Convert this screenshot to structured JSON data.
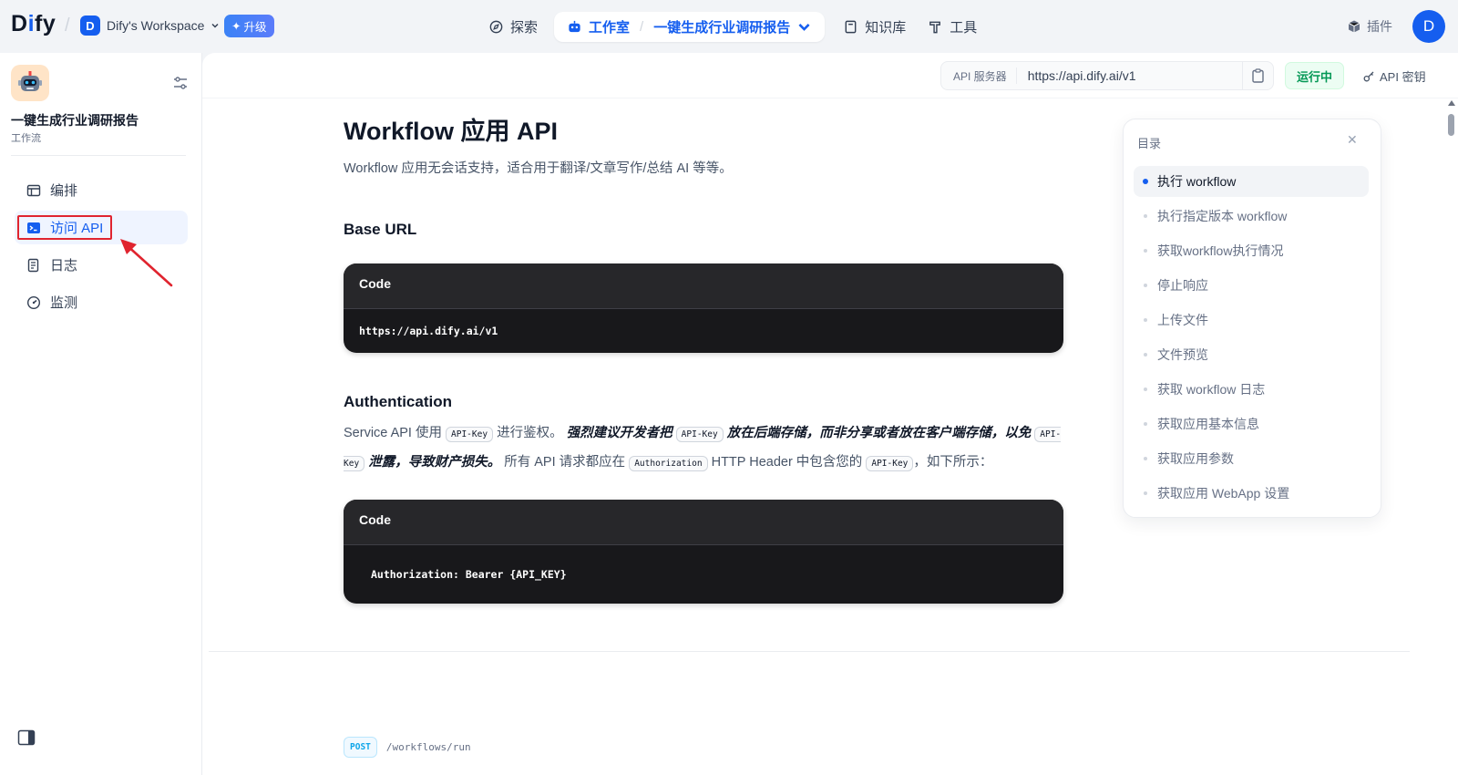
{
  "topnav": {
    "logo": "Dify",
    "workspace": {
      "avatar": "D",
      "name": "Dify's Workspace"
    },
    "upgrade": "升级",
    "explore": "探索",
    "studio": "工作室",
    "current_app": "一键生成行业调研报告",
    "knowledge": "知识库",
    "tools": "工具",
    "plugins": "插件",
    "user_avatar": "D"
  },
  "sidebar": {
    "app_name": "一键生成行业调研报告",
    "app_type": "工作流",
    "items": [
      {
        "label": "编排",
        "icon": "layout-icon"
      },
      {
        "label": "访问 API",
        "icon": "terminal-icon",
        "active": true
      },
      {
        "label": "日志",
        "icon": "log-icon"
      },
      {
        "label": "监测",
        "icon": "gauge-icon"
      }
    ]
  },
  "api_bar": {
    "server_label": "API 服务器",
    "server_url": "https://api.dify.ai/v1",
    "status": "运行中",
    "api_key": "API 密钥"
  },
  "doc": {
    "title": "Workflow 应用 API",
    "subtitle": "Workflow 应用无会话支持，适合用于翻译/文章写作/总结 AI 等等。",
    "base_url_heading": "Base URL",
    "code_label": "Code",
    "base_url_code": "https://api.dify.ai/v1",
    "auth_heading": "Authentication",
    "auth_p1": "Service API 使用",
    "auth_api_key": "API-Key",
    "auth_p2": "进行鉴权。",
    "auth_bold1": "强烈建议开发者把",
    "auth_bold2": "放在后端存储，而非分享或者放在客户端存储，以免",
    "auth_bold3": "泄露，导致财产损失。",
    "auth_p3": "所有 API 请求都应在",
    "auth_header_code": "Authorization",
    "auth_p4": "HTTP Header 中包含您的",
    "auth_p5": "，如下所示：",
    "auth_code": "Authorization: Bearer {API_KEY}",
    "endpoint_method": "POST",
    "endpoint_path": "/workflows/run"
  },
  "toc": {
    "title": "目录",
    "items": [
      "执行 workflow",
      "执行指定版本 workflow",
      "获取workflow执行情况",
      "停止响应",
      "上传文件",
      "文件预览",
      "获取 workflow 日志",
      "获取应用基本信息",
      "获取应用参数",
      "获取应用 WebApp 设置"
    ]
  },
  "colors": {
    "accent": "#155eef",
    "running": "#039855",
    "annotation": "#e0242f"
  }
}
